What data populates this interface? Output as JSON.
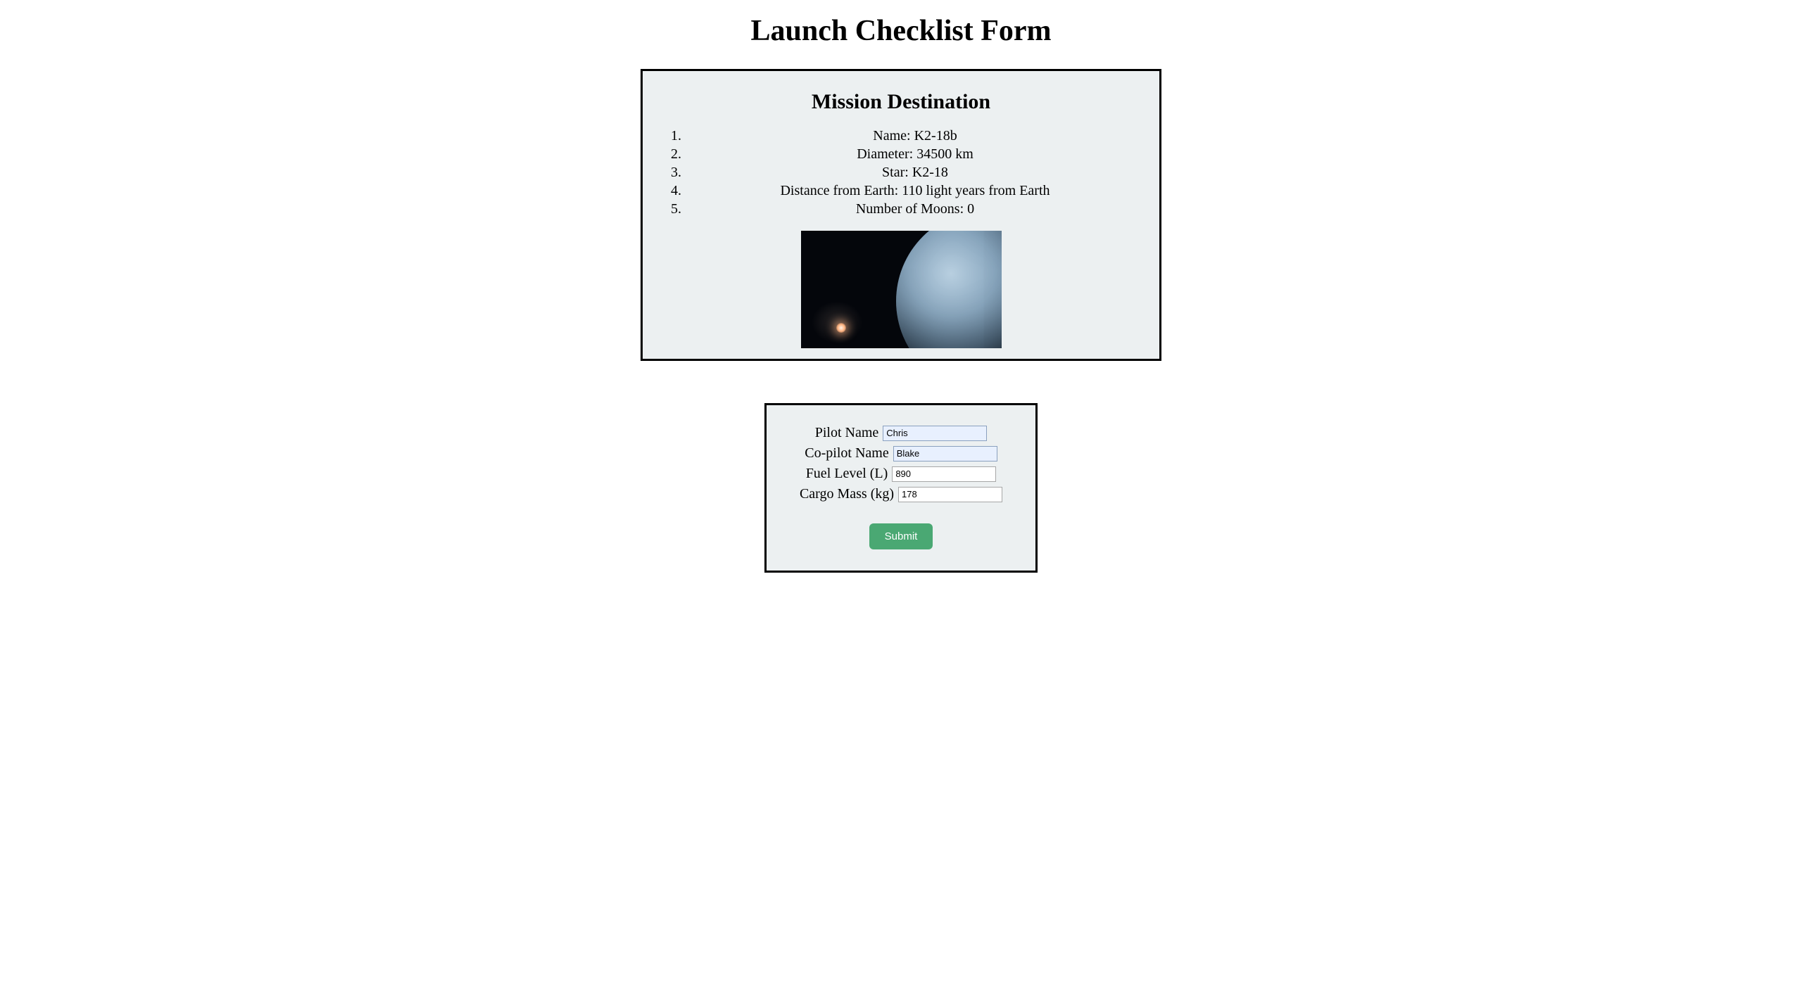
{
  "page": {
    "title": "Launch Checklist Form"
  },
  "mission": {
    "heading": "Mission Destination",
    "items": [
      "Name: K2-18b",
      "Diameter: 34500 km",
      "Star: K2-18",
      "Distance from Earth: 110 light years from Earth",
      "Number of Moons: 0"
    ]
  },
  "form": {
    "pilot_label": "Pilot Name",
    "pilot_value": "Chris",
    "copilot_label": "Co-pilot Name",
    "copilot_value": "Blake",
    "fuel_label": "Fuel Level (L)",
    "fuel_value": "890",
    "cargo_label": "Cargo Mass (kg)",
    "cargo_value": "178",
    "submit_label": "Submit"
  }
}
